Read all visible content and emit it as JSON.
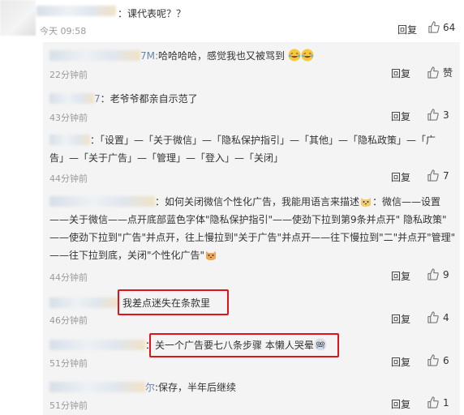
{
  "top_comment": {
    "text": "：课代表呢？？",
    "time": "今天 09:58",
    "reply_label": "回复",
    "like_count": "64"
  },
  "replies": [
    {
      "suffix": "7M:",
      "text": "哈哈哈哈，感觉我也又被骂到",
      "time": "22分钟前",
      "reply_label": "回复",
      "like_label": "赞",
      "emoji": "laugh-cry-emoji"
    },
    {
      "suffix": "7",
      "text": "：老爷爷都亲自示范了",
      "time": "43分钟前",
      "reply_label": "回复",
      "like_count": "3"
    },
    {
      "lines": [
        "：「设置」—「关于微信」—「隐私保护指引」—「其他」—「隐私政策」—「广",
        "告」—「关于广告」—「管理」—「登入」—「关闭」"
      ],
      "time": "44分钟前",
      "reply_label": "回复",
      "like_count": "7"
    },
    {
      "lines": [
        "：如何关闭微信个性化广告，我能用语言来描述",
        "：微信——设置",
        "——关于微信——点开底部蓝色字体\"隐私保护指引\"——使劲下拉到第9条并点开\" 隐私政策\"",
        "——使劲下拉到\"广告\"并点开，往上慢拉到\"关于广告\"并点开——往下慢拉到\"二\"并点开\"管理\"",
        "——往下拉到底，关闭\"个性化广告\""
      ],
      "time": "44分钟前",
      "reply_label": "回复",
      "like_count": "9"
    },
    {
      "text": "我差点迷失在条款里",
      "time": "46分钟前",
      "reply_label": "回复",
      "like_count": "4"
    },
    {
      "text": "关一个广告要七八条步骤 本懒人哭晕",
      "prefix": "：",
      "time": "51分钟前",
      "reply_label": "回复",
      "like_count": "6"
    },
    {
      "suffix": "尔",
      "text": ":保存，半年后继续",
      "time": "51分钟前",
      "reply_label": "回复",
      "like_count": "1"
    }
  ],
  "colors": {
    "highlight": "#e2121b",
    "panel_bg": "#f4f4f4",
    "meta": "#9a9a9a"
  }
}
